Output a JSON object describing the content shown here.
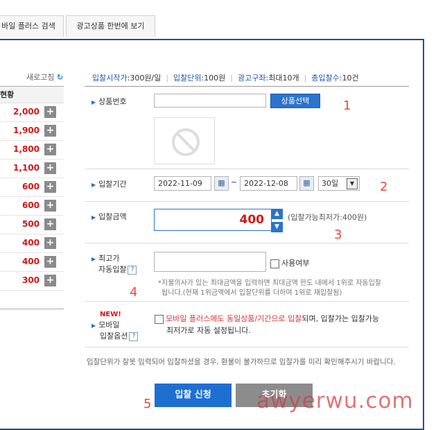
{
  "tabs": [
    "바일 플러스 검색",
    "광고상품 한번에 보기"
  ],
  "refresh": {
    "label": "새로고침",
    "icon": "refresh-icon"
  },
  "status": {
    "header": "현황",
    "values": [
      "2,000",
      "1,900",
      "1,800",
      "1,100",
      "600",
      "600",
      "500",
      "400",
      "400",
      "300"
    ]
  },
  "info": {
    "start_k": "입찰시작가",
    "start_v": ":300원/일",
    "unit_k": "입찰단위",
    "unit_v": ":100원",
    "slot_k": "광고구좌",
    "slot_v": ":최대10개",
    "total_k": "총입찰수",
    "total_v": ":10건"
  },
  "product": {
    "label": "상품번호",
    "value": "",
    "button": "상품선택"
  },
  "period": {
    "label": "입찰기간",
    "start": "2022-11-09",
    "tilde": "~",
    "end": "2022-12-08",
    "days": "30일"
  },
  "amount": {
    "label": "입찰금액",
    "value": "400",
    "hint": "(입찰가능최저가:400원)"
  },
  "auto": {
    "label1": "최고가",
    "label2": "자동입찰",
    "help": "?",
    "value": "",
    "use": "사용여부",
    "desc1": "*지불의사가 있는 최대금액을 입력하면 최대금액 한도 내에서 1위로 자동입찰",
    "desc2": "됩니다.(현재 1위금액에서 입찰단위를 더하여 1위로 재입찰됨)"
  },
  "mobile": {
    "new": "NEW!",
    "label1": "모바일",
    "label2": "입찰옵션",
    "help": "?",
    "text_red": "모바일 플러스에도 동일상품/기간으로 입찰",
    "text_rest": "되며, 입찰가는 입찰가능",
    "text2": "최저가로 자동 설정됩니다."
  },
  "notice": "입찰단위가 잘못 입력되어 입찰하셨을 경우, 환불이 불가하므로 입찰가를 미리 확인해주시기 바랍니다.",
  "buttons": {
    "submit": "입찰 신청",
    "reset": "초기화"
  },
  "markers": [
    "1",
    "2",
    "3",
    "4",
    "5"
  ],
  "watermark": "awyerwu.com",
  "colors": {
    "accent": "#2b73cc",
    "red": "#d41616",
    "frame": "#2b4f82"
  }
}
